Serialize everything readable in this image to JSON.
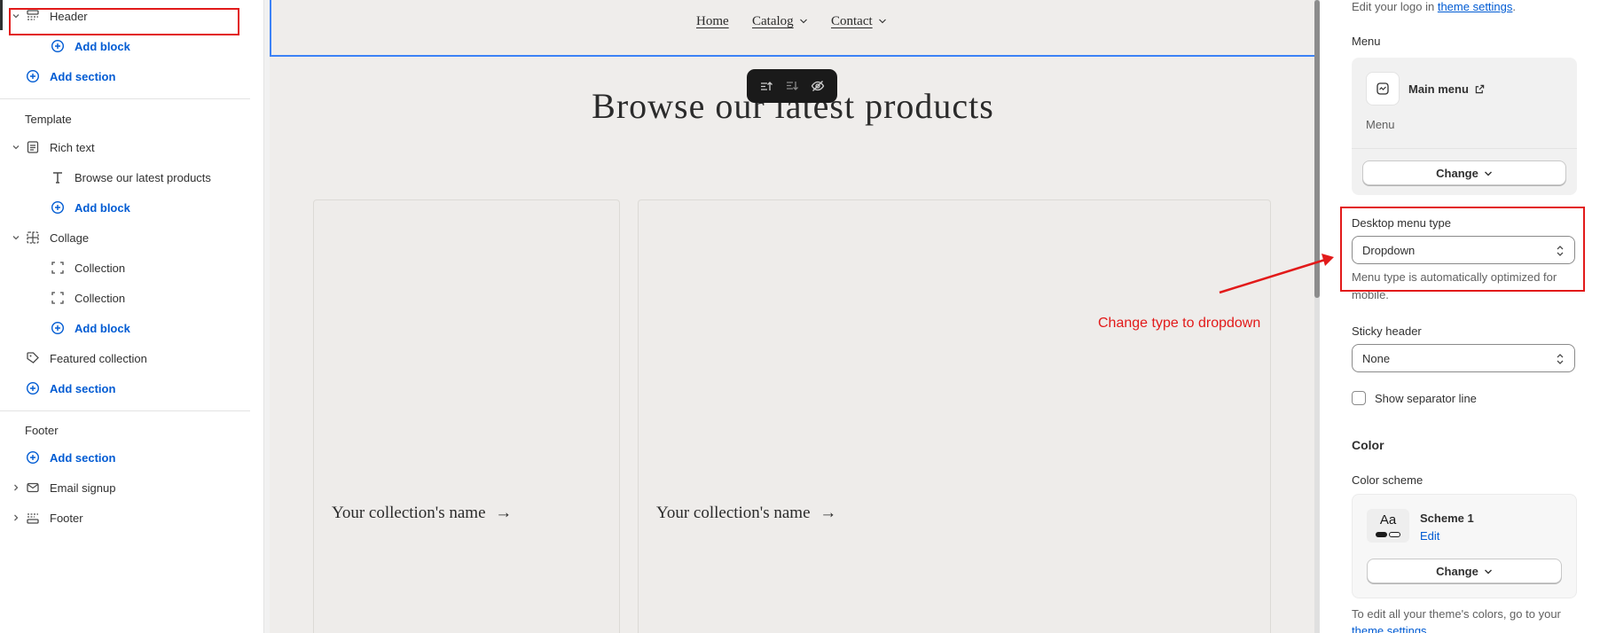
{
  "sidebar": {
    "header_label": "Header",
    "header_add_block": "Add block",
    "header_add_section": "Add section",
    "template_title": "Template",
    "rich_text_label": "Rich text",
    "rich_text_heading_block": "Browse our latest products",
    "rich_text_add_block": "Add block",
    "collage_label": "Collage",
    "collection_1": "Collection",
    "collection_2": "Collection",
    "collage_add_block": "Add block",
    "featured_collection_label": "Featured collection",
    "template_add_section": "Add section",
    "footer_title": "Footer",
    "footer_add_section": "Add section",
    "email_signup_label": "Email signup",
    "footer_label": "Footer"
  },
  "preview": {
    "nav": {
      "home": "Home",
      "catalog": "Catalog",
      "contact": "Contact"
    },
    "hero_title": "Browse our latest products",
    "card_1_name": "Your collection's name",
    "card_2_name": "Your collection's name",
    "annotation": "Change type to dropdown"
  },
  "panel": {
    "logo_hint_prefix": "Edit your logo in ",
    "logo_hint_link": "theme settings",
    "logo_hint_suffix": ".",
    "menu_label": "Menu",
    "menu_name": "Main menu",
    "menu_sub": "Menu",
    "menu_change": "Change",
    "desktop_menu_type_label": "Desktop menu type",
    "desktop_menu_type_value": "Dropdown",
    "desktop_menu_help_1": "Menu type is automatically optimized for",
    "desktop_menu_help_2": "mobile.",
    "sticky_header_label": "Sticky header",
    "sticky_header_value": "None",
    "separator_label": "Show separator line",
    "color_heading": "Color",
    "color_scheme_label": "Color scheme",
    "scheme_swatch": "Aa",
    "scheme_name": "Scheme 1",
    "scheme_edit": "Edit",
    "scheme_change": "Change",
    "colors_hint": "To edit all your theme's colors, go to your",
    "colors_hint_link": "theme settings"
  },
  "colors": {
    "accent_link": "#005bd3",
    "annotation_red": "#e21a1a",
    "selection_blue": "#3c82f6"
  }
}
